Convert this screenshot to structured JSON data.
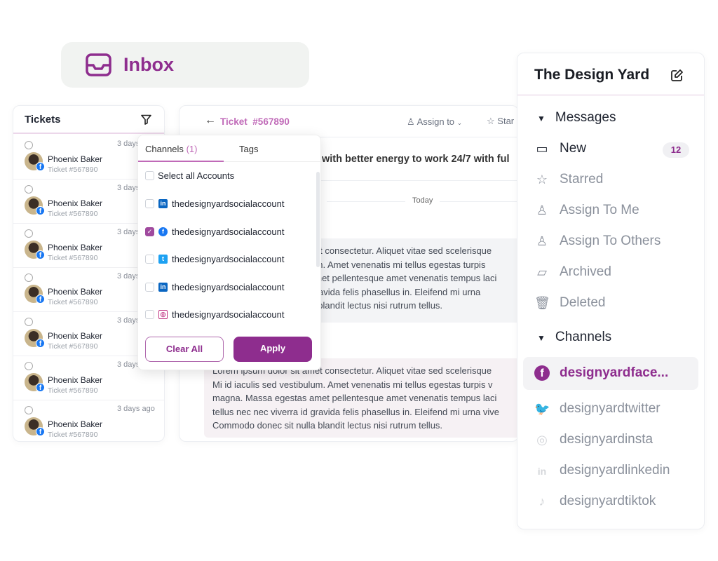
{
  "header": {
    "title": "Inbox"
  },
  "tickets": {
    "title": "Tickets",
    "rows": [
      {
        "name": "Phoenix Baker",
        "ticket": "Ticket #567890",
        "time": "3 days ago",
        "status": "globe"
      },
      {
        "name": "Phoenix Baker",
        "ticket": "Ticket #567890",
        "time": "3 days ago",
        "status": "lock"
      },
      {
        "name": "Phoenix Baker",
        "ticket": "Ticket #567890",
        "time": "3 days ago",
        "status": "globe"
      },
      {
        "name": "Phoenix Baker",
        "ticket": "Ticket #567890",
        "time": "3 days ago",
        "status": "lock"
      },
      {
        "name": "Phoenix Baker",
        "ticket": "Ticket #567890",
        "time": "3 days ago",
        "status": "globe"
      },
      {
        "name": "Phoenix Baker",
        "ticket": "Ticket #567890",
        "time": "3 days ago",
        "status": "lock"
      },
      {
        "name": "Phoenix Baker",
        "ticket": "Ticket #567890",
        "time": "3 days ago",
        "status": "globe"
      }
    ]
  },
  "ticket": {
    "label": "Ticket",
    "number": "#567890",
    "assign": "Assign to",
    "star": "Star",
    "subject": "with better energy to work 24/7 with ful",
    "divider": "Today",
    "message1": [
      "Lorem ipsum dolor sit amet consectetur. Aliquet vitae sed scelerisque",
      "Mi id iaculis sed vestibulum. Amet venenatis mi tellus egestas turpis",
      "magna. Massa egestas amet pellentesque amet venenatis tempus laci",
      "tellus nec nec viverra id gravida felis phasellus in. Eleifend mi urna",
      "Commodo donec sit nulla blandit lectus nisi rutrum tellus."
    ],
    "message2": [
      "Lorem ipsum dolor sit amet consectetur. Aliquet vitae sed scelerisque",
      "Mi id iaculis sed vestibulum. Amet venenatis mi tellus egestas turpis v",
      "magna. Massa egestas amet pellentesque amet venenatis tempus laci",
      "tellus nec nec viverra id gravida felis phasellus in. Eleifend mi urna vive",
      "Commodo donec sit nulla blandit lectus nisi rutrum tellus."
    ]
  },
  "filter": {
    "tab_channels": "Channels",
    "channels_count": "(1)",
    "tab_tags": "Tags",
    "select_all": "Select all Accounts",
    "accounts": [
      {
        "name": "thedesignyardsocialaccount",
        "network": "linkedin",
        "checked": false
      },
      {
        "name": "thedesignyardsocialaccount",
        "network": "facebook",
        "checked": true
      },
      {
        "name": "thedesignyardsocialaccount",
        "network": "twitter",
        "checked": false
      },
      {
        "name": "thedesignyardsocialaccount",
        "network": "linkedin",
        "checked": false
      },
      {
        "name": "thedesignyardsocialaccount",
        "network": "instagram",
        "checked": false
      }
    ],
    "clear": "Clear All",
    "apply": "Apply"
  },
  "sidebar": {
    "title": "The Design Yard",
    "messages_label": "Messages",
    "items": [
      {
        "label": "New",
        "badge": "12"
      },
      {
        "label": "Starred"
      },
      {
        "label": "Assign To Me"
      },
      {
        "label": "Assign To Others"
      },
      {
        "label": "Archived"
      },
      {
        "label": "Deleted"
      }
    ],
    "channels_label": "Channels",
    "channels": [
      {
        "label": "designyardface...",
        "network": "facebook",
        "selected": true
      },
      {
        "label": "designyardtwitter",
        "network": "twitter"
      },
      {
        "label": "designyardinsta",
        "network": "instagram"
      },
      {
        "label": "designyardlinkedin",
        "network": "linkedin"
      },
      {
        "label": "designyardtiktok",
        "network": "tiktok"
      }
    ]
  },
  "colors": {
    "accent": "#8e2d8e",
    "facebook": "#1877f2",
    "twitter": "#1da1f2",
    "linkedin": "#0a66c2",
    "instagram": "#c13584"
  }
}
